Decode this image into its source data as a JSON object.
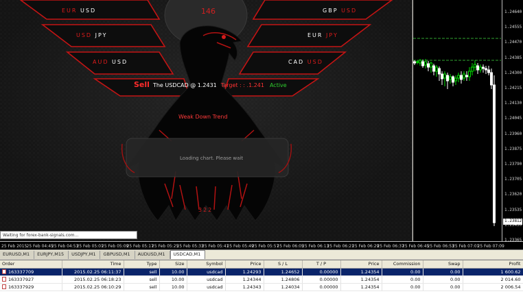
{
  "overlay": {
    "head_number": "146",
    "bottom_number": "322",
    "pairs_left": [
      {
        "base": "EUR",
        "quote": "USD"
      },
      {
        "base": "USD",
        "quote": "JPY"
      },
      {
        "base": "AUD",
        "quote": "USD"
      }
    ],
    "pairs_right": [
      {
        "base": "GBP",
        "quote": "USD"
      },
      {
        "base": "EUR",
        "quote": "JPY"
      },
      {
        "base": "CAD",
        "quote": "USD"
      }
    ],
    "signal": {
      "action": "Sell",
      "text": "The USDCAD @ 1.2431",
      "target": "Target : : .1.241",
      "status": "Active"
    },
    "trend": "Weak Down Trend",
    "loading": "Loading chart. Please wait",
    "status_text": "Waiting for forex-bank-signals.com..."
  },
  "chart": {
    "price_ticks": [
      "1.24640",
      "1.24555",
      "1.24470",
      "1.24385",
      "1.24300",
      "1.24215",
      "1.24130",
      "1.24045",
      "1.23960",
      "1.23875",
      "1.23790",
      "1.23705",
      "1.23620",
      "1.23535",
      "1.23450",
      "1.23365"
    ],
    "current_price": "1.23812",
    "time_ticks": [
      "25 Feb 2015",
      "25 Feb 04:45",
      "25 Feb 04:53",
      "25 Feb 05:01",
      "25 Feb 05:09",
      "25 Feb 05:17",
      "25 Feb 05:25",
      "25 Feb 05:33",
      "25 Feb 05:41",
      "25 Feb 05:49",
      "25 Feb 05:57",
      "25 Feb 06:05",
      "25 Feb 06:13",
      "25 Feb 06:21",
      "25 Feb 06:29",
      "25 Feb 06:37",
      "25 Feb 06:45",
      "25 Feb 06:53",
      "25 Feb 07:01",
      "25 Feb 07:09"
    ],
    "colors": {
      "bull": "#00e000",
      "bear": "#ffffff",
      "level": "#2fa52f"
    }
  },
  "tabs": [
    {
      "label": "EURUSD,M1",
      "active": false
    },
    {
      "label": "EURJPY,M15",
      "active": false
    },
    {
      "label": "USDJPY,M1",
      "active": false
    },
    {
      "label": "GBPUSD,M1",
      "active": false
    },
    {
      "label": "AUDUSD,M1",
      "active": false
    },
    {
      "label": "USDCAD,M1",
      "active": true
    }
  ],
  "orders": {
    "columns": [
      "Order",
      "Time",
      "Type",
      "Size",
      "Symbol",
      "Price",
      "S / L",
      "T / P",
      "Price",
      "Commission",
      "Swap",
      "Profit"
    ],
    "rows": [
      {
        "order": "163337709",
        "time": "2015.02.25 06:11:37",
        "type": "sell",
        "size": "10.00",
        "symbol": "usdcad",
        "price": "1.24293",
        "sl": "1.24652",
        "tp": "0.00000",
        "cur": "1.24354",
        "commission": "0.00",
        "swap": "0.00",
        "profit": "1 600.62",
        "selected": true
      },
      {
        "order": "163337927",
        "time": "2015.02.25 06:18:23",
        "type": "sell",
        "size": "10.00",
        "symbol": "usdcad",
        "price": "1.24344",
        "sl": "1.24806",
        "tp": "0.00000",
        "cur": "1.24354",
        "commission": "0.00",
        "swap": "0.00",
        "profit": "2 014.60",
        "selected": false
      },
      {
        "order": "163337929",
        "time": "2015.02.25 06:10:29",
        "type": "sell",
        "size": "10.00",
        "symbol": "usdcad",
        "price": "1.24343",
        "sl": "1.24034",
        "tp": "0.00000",
        "cur": "1.24354",
        "commission": "0.00",
        "swap": "0.00",
        "profit": "2 006.54",
        "selected": false
      }
    ]
  }
}
